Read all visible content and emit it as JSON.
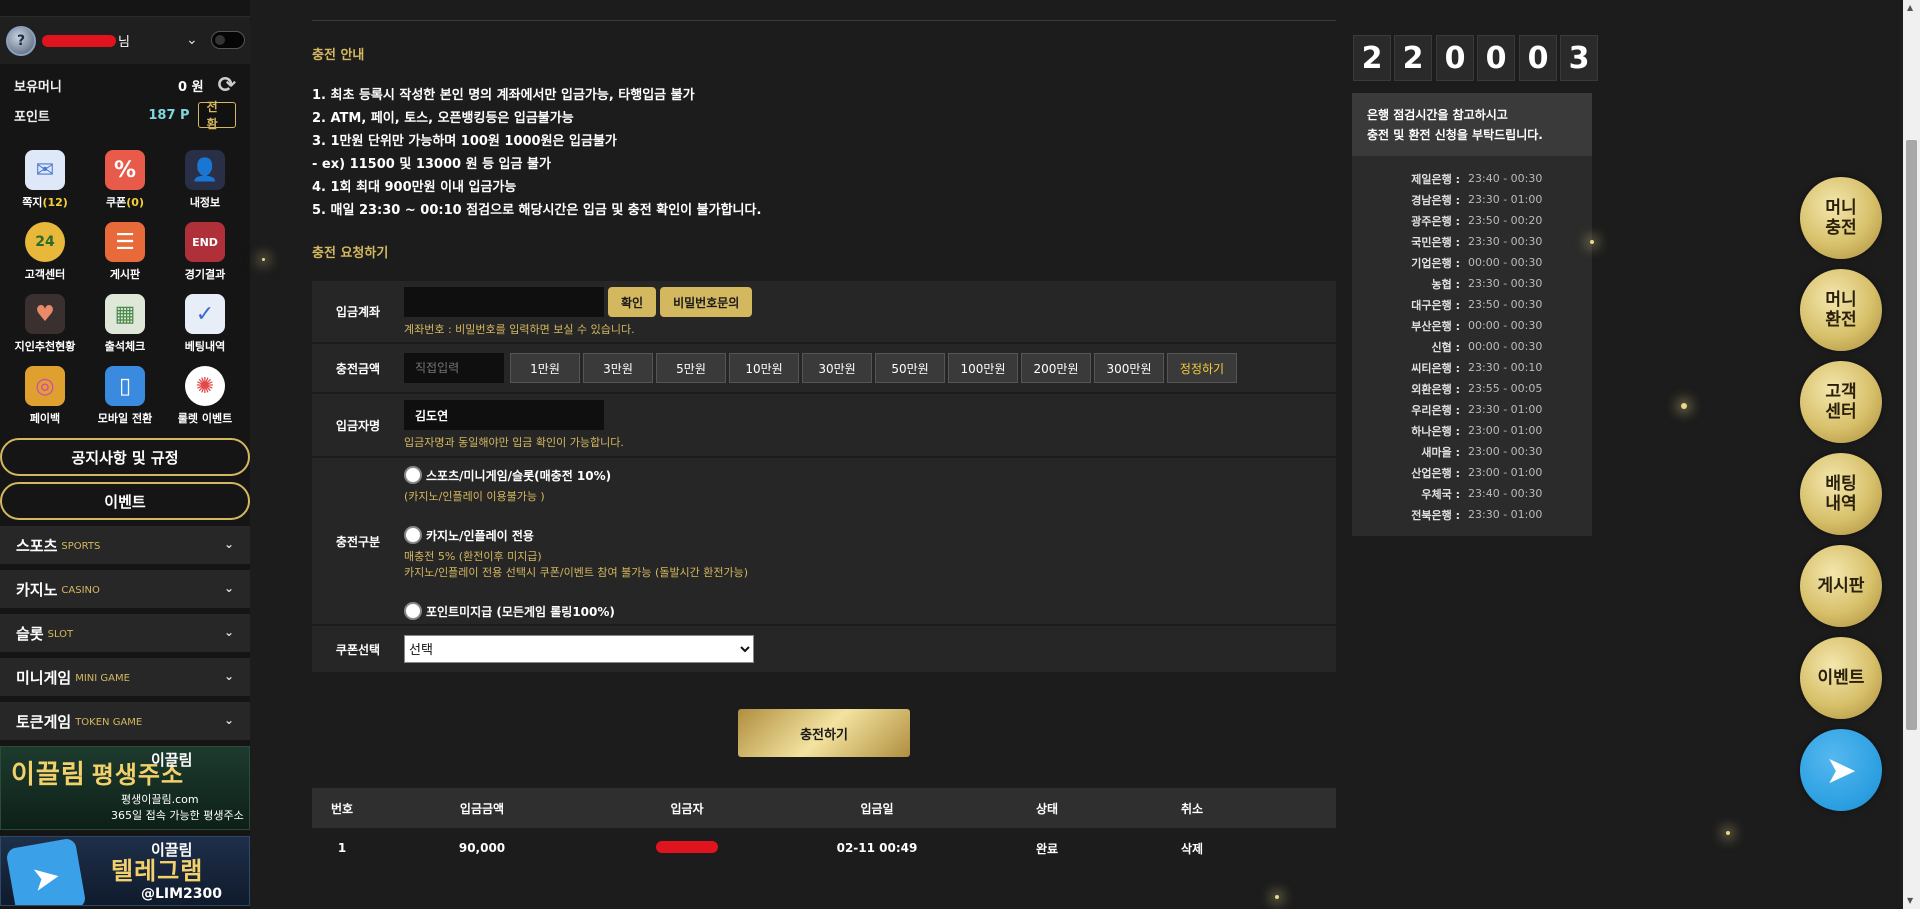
{
  "user": {
    "suffix": "님"
  },
  "balance": {
    "money_label": "보유머니",
    "money_value": "0 원",
    "points_label": "포인트",
    "points_value": "187 P",
    "convert_label": "전환"
  },
  "menu": [
    {
      "label": "쪽지",
      "count": "(12)",
      "icon": "✉",
      "color": "#7da8e6"
    },
    {
      "label": "쿠폰",
      "count": "(0)",
      "icon": "%",
      "color": "#e85a4a"
    },
    {
      "label": "내정보",
      "count": "",
      "icon": "👤",
      "color": "#6a7fd0"
    },
    {
      "label": "고객센터",
      "count": "",
      "icon": "24",
      "color": "#e8b83a"
    },
    {
      "label": "게시판",
      "count": "",
      "icon": "☰",
      "color": "#e86a3a"
    },
    {
      "label": "경기결과",
      "count": "",
      "icon": "END",
      "color": "#b0303a"
    },
    {
      "label": "지인추천현황",
      "count": "",
      "icon": "♥",
      "color": "#e88a6a"
    },
    {
      "label": "출석체크",
      "count": "",
      "icon": "▦",
      "color": "#6ab06a"
    },
    {
      "label": "베팅내역",
      "count": "",
      "icon": "✓",
      "color": "#4a7ad0"
    },
    {
      "label": "페이백",
      "count": "",
      "icon": "◎",
      "color": "#d04ab0"
    },
    {
      "label": "모바일 전환",
      "count": "",
      "icon": "▯",
      "color": "#3a8ae0"
    },
    {
      "label": "룰렛 이벤트",
      "count": "",
      "icon": "✺",
      "color": "#e04a4a"
    }
  ],
  "sidebar_buttons": {
    "notice": "공지사항 및 규정",
    "event": "이벤트"
  },
  "categories": [
    {
      "ko": "스포츠",
      "en": "SPORTS"
    },
    {
      "ko": "카지노",
      "en": "CASINO"
    },
    {
      "ko": "슬롯",
      "en": "SLOT"
    },
    {
      "ko": "미니게임",
      "en": "MINI GAME"
    },
    {
      "ko": "토큰게임",
      "en": "TOKEN GAME"
    }
  ],
  "banners": {
    "b1_sub": "이끌림",
    "b1_big": "이끌림",
    "b1_title": "평생주소",
    "b1_url": "평생이끌림.com",
    "b1_small": "365일 접속 가능한 평생주소",
    "b2_sub": "이끌림",
    "b2_title": "텔레그램",
    "b2_handle": "@LIM2300"
  },
  "main": {
    "guide_title": "충전 안내",
    "notices": [
      "1. 최초 등록시 작성한 본인 명의 계좌에서만 입금가능, 타행입금 불가",
      "2. ATM, 페이, 토스, 오픈뱅킹등은 입금불가능",
      "3. 1만원 단위만 가능하며 100원 1000원은 입금불가",
      "- ex) 11500 및 13000 원 등 입금 불가",
      "4. 1회 최대 900만원 이내 입금가능",
      "5. 매일 23:30 ~ 00:10 점검으로 해당시간은 입금 및 충전 확인이 불가합니다."
    ],
    "request_title": "충전 요청하기",
    "account": {
      "label": "입금계좌",
      "confirm": "확인",
      "password_inquiry": "비밀번호문의",
      "hint": "계좌번호 : 비밀번호를 입력하면 보실 수 있습니다."
    },
    "amount": {
      "label": "충전금액",
      "placeholder": "직접입력",
      "options": [
        "1만원",
        "3만원",
        "5만원",
        "10만원",
        "30만원",
        "50만원",
        "100만원",
        "200만원",
        "300만원"
      ],
      "reset": "정정하기"
    },
    "depositor": {
      "label": "입금자명",
      "value": "김도연",
      "hint": "입금자명과 동일해야만 입금 확인이 가능합니다."
    },
    "charge_type": {
      "label": "충전구분",
      "opt1": "스포츠/미니게임/슬롯(매충전 10%)",
      "opt1_note": "(카지노/인플레이 이용불가능 )",
      "opt2": "카지노/인플레이 전용",
      "opt2_note1": "매충전 5% (환전이후 미지급)",
      "opt2_note2": "카지노/인플레이 전용 선택시 쿠폰/이벤트 참여 불가능 (돌발시간 환전가능)",
      "opt3": "포인트미지급 (모든게임 롤링100%)"
    },
    "coupon": {
      "label": "쿠폰선택",
      "selected": "선택"
    },
    "submit": "충전하기",
    "history": {
      "headers": [
        "번호",
        "입금금액",
        "입금자",
        "입금일",
        "상태",
        "취소"
      ],
      "rows": [
        {
          "no": "1",
          "amount": "90,000",
          "date": "02-11 00:49",
          "status": "완료",
          "cancel": "삭제"
        }
      ]
    }
  },
  "clock": [
    "2",
    "2",
    "0",
    "0",
    "0",
    "3"
  ],
  "bank_hours": {
    "head_line1": "은행 점검시간을 참고하시고",
    "head_line2": "충전 및 환전 신청을 부탁드립니다.",
    "banks": [
      {
        "name": "제일은행 :",
        "time": "23:40 - 00:30"
      },
      {
        "name": "경남은행 :",
        "time": "23:30 - 01:00"
      },
      {
        "name": "광주은행 :",
        "time": "23:50 - 00:20"
      },
      {
        "name": "국민은행 :",
        "time": "23:30 - 00:30"
      },
      {
        "name": "기업은행 :",
        "time": "00:00 - 00:30"
      },
      {
        "name": "농협 :",
        "time": "23:30 - 00:30"
      },
      {
        "name": "대구은행 :",
        "time": "23:50 - 00:30"
      },
      {
        "name": "부산은행 :",
        "time": "00:00 - 00:30"
      },
      {
        "name": "신협 :",
        "time": "00:00 - 00:30"
      },
      {
        "name": "씨티은행 :",
        "time": "23:30 - 00:10"
      },
      {
        "name": "외환은행 :",
        "time": "23:55 - 00:05"
      },
      {
        "name": "우리은행 :",
        "time": "23:30 - 01:00"
      },
      {
        "name": "하나은행 :",
        "time": "23:00 - 01:00"
      },
      {
        "name": "새마을 :",
        "time": "23:00 - 00:30"
      },
      {
        "name": "산업은행 :",
        "time": "23:00 - 01:00"
      },
      {
        "name": "우체국 :",
        "time": "23:40 - 00:30"
      },
      {
        "name": "전북은행 :",
        "time": "23:30 - 01:00"
      }
    ]
  },
  "fabs": [
    "머니\n충전",
    "머니\n환전",
    "고객\n센터",
    "배팅\n내역",
    "게시판",
    "이벤트"
  ]
}
